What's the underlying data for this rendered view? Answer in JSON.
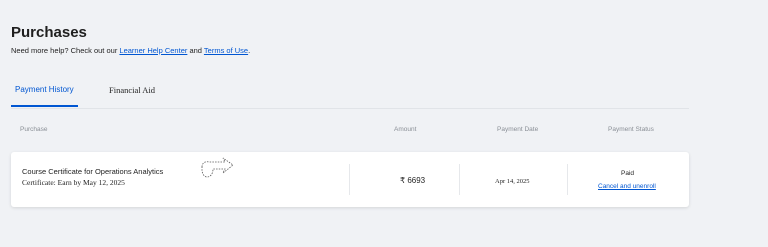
{
  "page": {
    "title": "Purchases",
    "help_prefix": "Need more help? Check out our ",
    "help_link_1": "Learner Help Center",
    "help_middle": " and ",
    "help_link_2": "Terms of Use",
    "help_suffix": "."
  },
  "tabs": [
    {
      "label": "Payment History",
      "active": true
    },
    {
      "label": "Financial Aid",
      "active": false
    }
  ],
  "columns": {
    "purchase": "Purchase",
    "amount": "Amount",
    "payment_date": "Payment Date",
    "payment_status": "Payment Status"
  },
  "rows": [
    {
      "course": "Course Certificate for Operations Analytics",
      "certificate": "Certificate: Earn by May 12, 2025",
      "amount": "₹ 6693",
      "payment_date": "Apr 14, 2025",
      "status": "Paid",
      "action": "Cancel and unenroll"
    }
  ],
  "colors": {
    "accent": "#0056d2",
    "background": "#f0f2f5"
  },
  "icons": {
    "pointer": "hand-pointer-icon"
  }
}
